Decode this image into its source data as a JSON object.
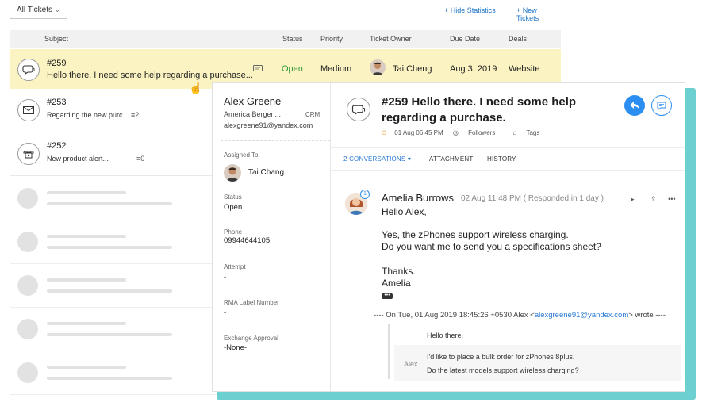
{
  "topbar": {
    "filter_label": "All Tickets",
    "hide_stats": "+ Hide Statistics",
    "new_tickets": "+ New Tickets"
  },
  "table": {
    "headers": {
      "subject": "Subject",
      "status": "Status",
      "priority": "Priority",
      "owner": "Ticket Owner",
      "due": "Due Date",
      "deals": "Deals"
    },
    "active_row": {
      "number": "#259",
      "subject": "Hello there. I need some help regarding a purchase...",
      "status": "Open",
      "priority": "Medium",
      "owner": "Tai Cheng",
      "due": "Aug 3, 2019",
      "deals": "Website"
    },
    "rows": [
      {
        "number": "#253",
        "subject": "Regarding the new purc...",
        "count": "2",
        "icon": "envelope-icon"
      },
      {
        "number": "#252",
        "subject": "New product alert...",
        "count": "0",
        "icon": "phone-icon"
      }
    ]
  },
  "panel": {
    "contact": {
      "name": "Alex Greene",
      "org": "America Bergen...",
      "crm": "CRM",
      "email": "alexgreene91@yandex.com"
    },
    "fields": {
      "assigned_label": "Assigned To",
      "assigned_value": "Tai Chang",
      "status_label": "Status",
      "status_value": "Open",
      "phone_label": "Phone",
      "phone_value": "09944644105",
      "attempt_label": "Attempt",
      "attempt_value": "-",
      "rma_label": "RMA Label Number",
      "rma_value": "-",
      "exchange_label": "Exchange Approval",
      "exchange_value": "-None-"
    },
    "ticket": {
      "title": "#259 Hello there. I need some help regarding a purchase.",
      "date": "01 Aug 06:45 PM",
      "followers": "Followers",
      "tags": "Tags"
    },
    "tabs": {
      "conversations": "2 CONVERSATIONS",
      "attachment": "ATTACHMENT",
      "history": "HISTORY"
    },
    "message": {
      "badge": "1",
      "sender": "Amelia Burrows",
      "meta": "02 Aug 11:48 PM ( Responded in 1 day )",
      "greeting": "Hello Alex,",
      "line1": "Yes, the zPhones support wireless charging.",
      "line2": "Do you want me to send you a specifications sheet?",
      "thanks": "Thanks.",
      "signature": "Amelia",
      "quote_prefix": "---- On Tue, 01 Aug 2019 18:45:26 +0530 Alex <",
      "quote_email": "alexgreene91@yandex.com",
      "quote_suffix": "> wrote ----",
      "quote_hello": "Hello there,",
      "quote_alex": "Alex",
      "quote_line1": "I'd like to place a bulk order for zPhones 8plus.",
      "quote_line2": "Do the latest models support wireless charging?"
    }
  },
  "colors": {
    "accent": "#2b8ef0",
    "panel_shadow": "#6ccfd0",
    "active_row": "#fbf3c2",
    "status_open": "#2c9a3a"
  }
}
